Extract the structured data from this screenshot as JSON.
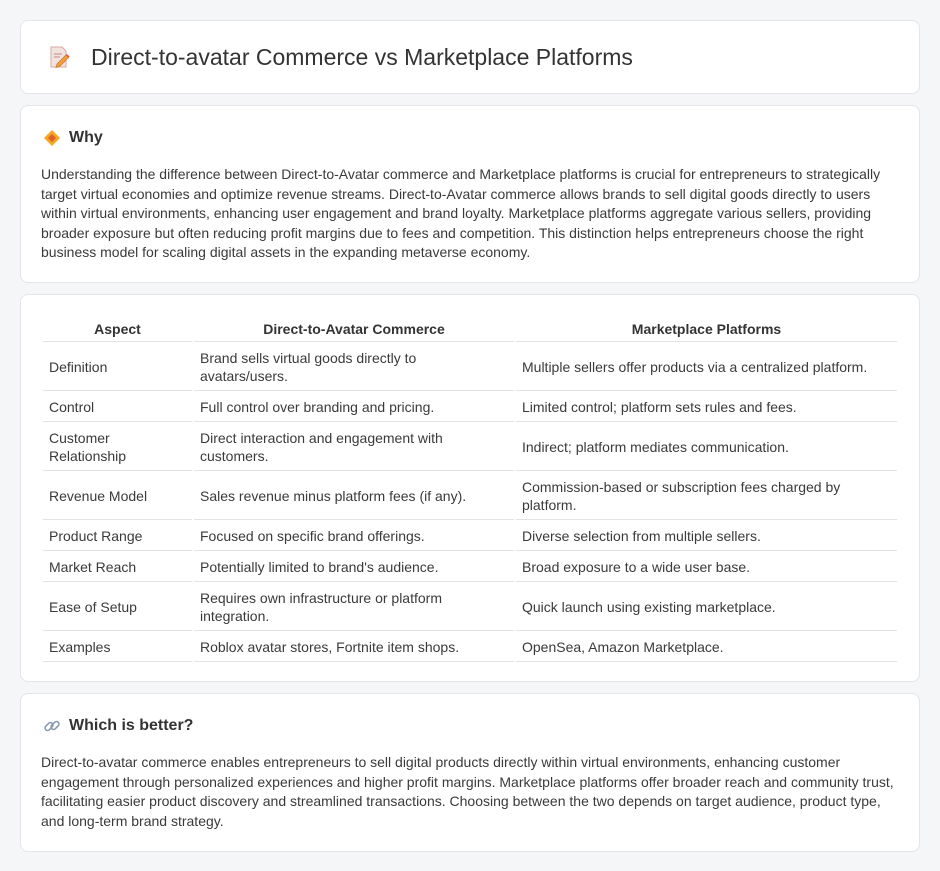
{
  "header": {
    "title": "Direct-to-avatar Commerce vs Marketplace Platforms",
    "icon": "document-pencil-icon"
  },
  "why": {
    "title": "Why",
    "icon": "diamond-icon",
    "text": "Understanding the difference between Direct-to-Avatar commerce and Marketplace platforms is crucial for entrepreneurs to strategically target virtual economies and optimize revenue streams. Direct-to-Avatar commerce allows brands to sell digital goods directly to users within virtual environments, enhancing user engagement and brand loyalty. Marketplace platforms aggregate various sellers, providing broader exposure but often reducing profit margins due to fees and competition. This distinction helps entrepreneurs choose the right business model for scaling digital assets in the expanding metaverse economy."
  },
  "table": {
    "headers": [
      "Aspect",
      "Direct-to-Avatar Commerce",
      "Marketplace Platforms"
    ],
    "rows": [
      [
        "Definition",
        "Brand sells virtual goods directly to avatars/users.",
        "Multiple sellers offer products via a centralized platform."
      ],
      [
        "Control",
        "Full control over branding and pricing.",
        "Limited control; platform sets rules and fees."
      ],
      [
        "Customer Relationship",
        "Direct interaction and engagement with customers.",
        "Indirect; platform mediates communication."
      ],
      [
        "Revenue Model",
        "Sales revenue minus platform fees (if any).",
        "Commission-based or subscription fees charged by platform."
      ],
      [
        "Product Range",
        "Focused on specific brand offerings.",
        "Diverse selection from multiple sellers."
      ],
      [
        "Market Reach",
        "Potentially limited to brand's audience.",
        "Broad exposure to a wide user base."
      ],
      [
        "Ease of Setup",
        "Requires own infrastructure or platform integration.",
        "Quick launch using existing marketplace."
      ],
      [
        "Examples",
        "Roblox avatar stores, Fortnite item shops.",
        "OpenSea, Amazon Marketplace."
      ]
    ]
  },
  "better": {
    "title": "Which is better?",
    "icon": "link-icon",
    "text": "Direct-to-avatar commerce enables entrepreneurs to sell digital products directly within virtual environments, enhancing customer engagement through personalized experiences and higher profit margins. Marketplace platforms offer broader reach and community trust, facilitating easier product discovery and streamlined transactions. Choosing between the two depends on target audience, product type, and long-term brand strategy."
  }
}
